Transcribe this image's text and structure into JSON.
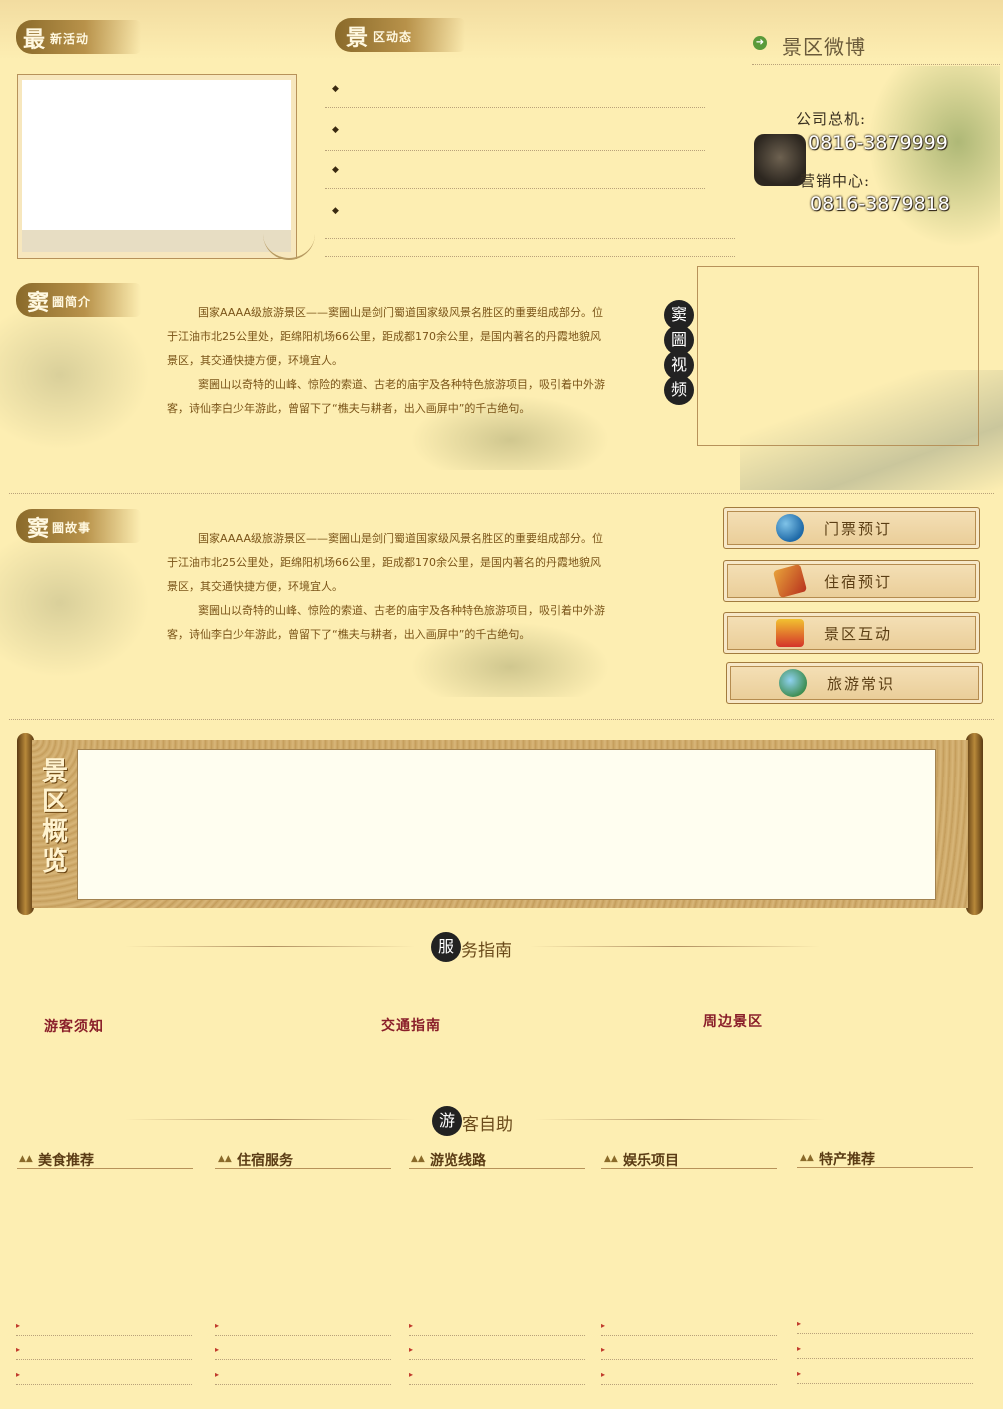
{
  "top": {
    "latest_events": {
      "big": "最",
      "small": "新活动"
    },
    "scenic_news": {
      "big": "景",
      "small": "区动态"
    },
    "news_items": [
      "",
      "",
      "",
      ""
    ],
    "weibo_title": "景区微博",
    "contact": {
      "hotline_label": "公司总机:",
      "hotline_number": "0816-3879999",
      "sales_label": "营销中心:",
      "sales_number": "0816-3879818"
    }
  },
  "intro": {
    "header_big": "窦",
    "header_small": "圌简介",
    "paragraph1": "国家AAAA级旅游景区——窦圌山是剑门蜀道国家级风景名胜区的重要组成部分。位于江油市北25公里处，距绵阳机场66公里，距成都170余公里，是国内著名的丹霞地貌风景区，其交通快捷方便，环境宜人。",
    "paragraph2": "窦圌山以奇特的山峰、惊险的索道、古老的庙宇及各种特色旅游项目，吸引着中外游客，诗仙李白少年游此，曾留下了“樵夫与耕者，出入画屏中”的千古绝句。",
    "video_chars": [
      "窦",
      "圌",
      "视",
      "频"
    ]
  },
  "story": {
    "header_big": "窦",
    "header_small": "圌故事",
    "paragraph1": "国家AAAA级旅游景区——窦圌山是剑门蜀道国家级风景名胜区的重要组成部分。位于江油市北25公里处，距绵阳机场66公里，距成都170余公里，是国内著名的丹霞地貌风景区，其交通快捷方便，环境宜人。",
    "paragraph2": "窦圌山以奇特的山峰、惊险的索道、古老的庙宇及各种特色旅游项目，吸引着中外游客，诗仙李白少年游此，曾留下了“樵夫与耕者，出入画屏中”的千古绝句。"
  },
  "quick_buttons": [
    {
      "label": "门票预订",
      "icon": "globe-icon"
    },
    {
      "label": "住宿预订",
      "icon": "card-icon"
    },
    {
      "label": "景区互动",
      "icon": "gift-icon"
    },
    {
      "label": "旅游常识",
      "icon": "plane-icon"
    }
  ],
  "overview": {
    "chars": [
      "景",
      "区",
      "概",
      "览"
    ]
  },
  "service": {
    "title_char": "服",
    "title_rest": "务指南",
    "items": [
      "游客须知",
      "交通指南",
      "周边景区"
    ]
  },
  "self_help": {
    "title_char": "游",
    "title_rest": "客自助",
    "columns": [
      {
        "title": "美食推荐"
      },
      {
        "title": "住宿服务"
      },
      {
        "title": "游览线路"
      },
      {
        "title": "娱乐项目"
      },
      {
        "title": "特产推荐"
      }
    ]
  },
  "colors": {
    "background": "#fdeeb2",
    "accent": "#8a6a2a",
    "link_red": "#8a1f2a"
  }
}
